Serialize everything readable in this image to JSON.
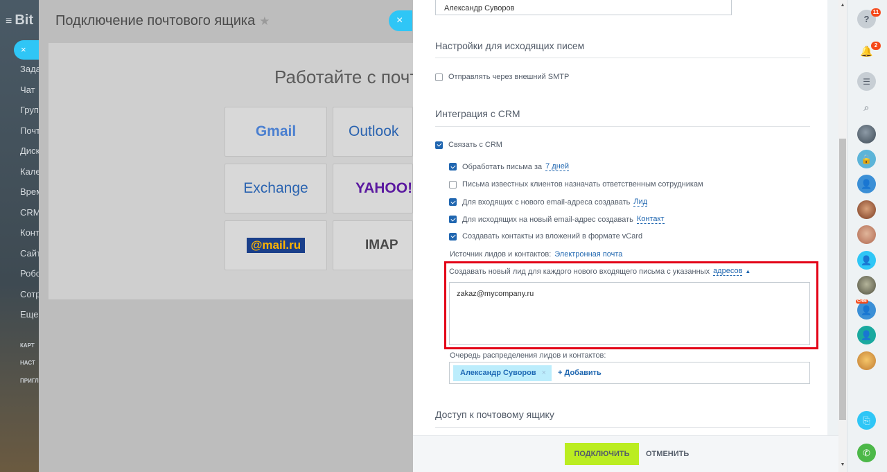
{
  "app": {
    "logo_text": "Bit",
    "search_pill": "×",
    "menu": [
      "Зада",
      "Чат",
      "Груп",
      "Почт",
      "Диск",
      "Кале",
      "Врем",
      "CRM",
      "Конт",
      "Сайт",
      "Робо",
      "Сотр",
      "Еще"
    ],
    "menu_small": [
      "КАРТ",
      "НАСТ",
      "ПРИГЛ"
    ]
  },
  "main": {
    "title": "Подключение почтового ящика",
    "star_icon": "star-icon",
    "headline": "Работайте с почт",
    "providers": [
      "Gmail",
      "Outlook",
      "Exchange",
      "YAHOO!",
      "@mail.ru",
      "IMAP"
    ]
  },
  "close_label": "×",
  "form": {
    "name_value": "Александр Суворов",
    "outgoing_title": "Настройки для исходящих писем",
    "smtp_label": "Отправлять через внешний SMTP",
    "smtp_checked": false,
    "crm_title": "Интеграция с CRM",
    "crm_link_label": "Связать с CRM",
    "process_label": "Обработать письма за",
    "process_link": "7 дней",
    "known_clients_label": "Письма известных клиентов назначать ответственным сотрудникам",
    "incoming_label": "Для входящих с нового email-адреса создавать",
    "incoming_link": "Лид",
    "outgoing_label": "Для исходящих на новый email-адрес создавать",
    "outgoing_link": "Контакт",
    "vcard_label": "Создавать контакты из вложений в формате vCard",
    "source_label": "Источник лидов и контактов:",
    "source_link": "Электронная почта",
    "new_lead_label": "Создавать новый лид для каждого нового входящего письма с указанных",
    "new_lead_link": "адресов",
    "addresses_value": "zakaz@mycompany.ru",
    "queue_label": "Очередь распределения лидов и контактов:",
    "queue_tag": "Александр Суворов",
    "queue_tag_remove": "×",
    "queue_add": "+ Добавить",
    "access_title": "Доступ к почтовому ящику"
  },
  "footer": {
    "connect": "ПОДКЛЮЧИТЬ",
    "cancel": "ОТМЕНИТЬ"
  },
  "rail": {
    "help_badge": "11",
    "notify_badge": "2",
    "crm_badge": "CRM"
  },
  "colors": {
    "accent": "#2fc6f6",
    "highlight": "#e30016",
    "connect_button": "#bbed21",
    "link": "#2067b0"
  }
}
